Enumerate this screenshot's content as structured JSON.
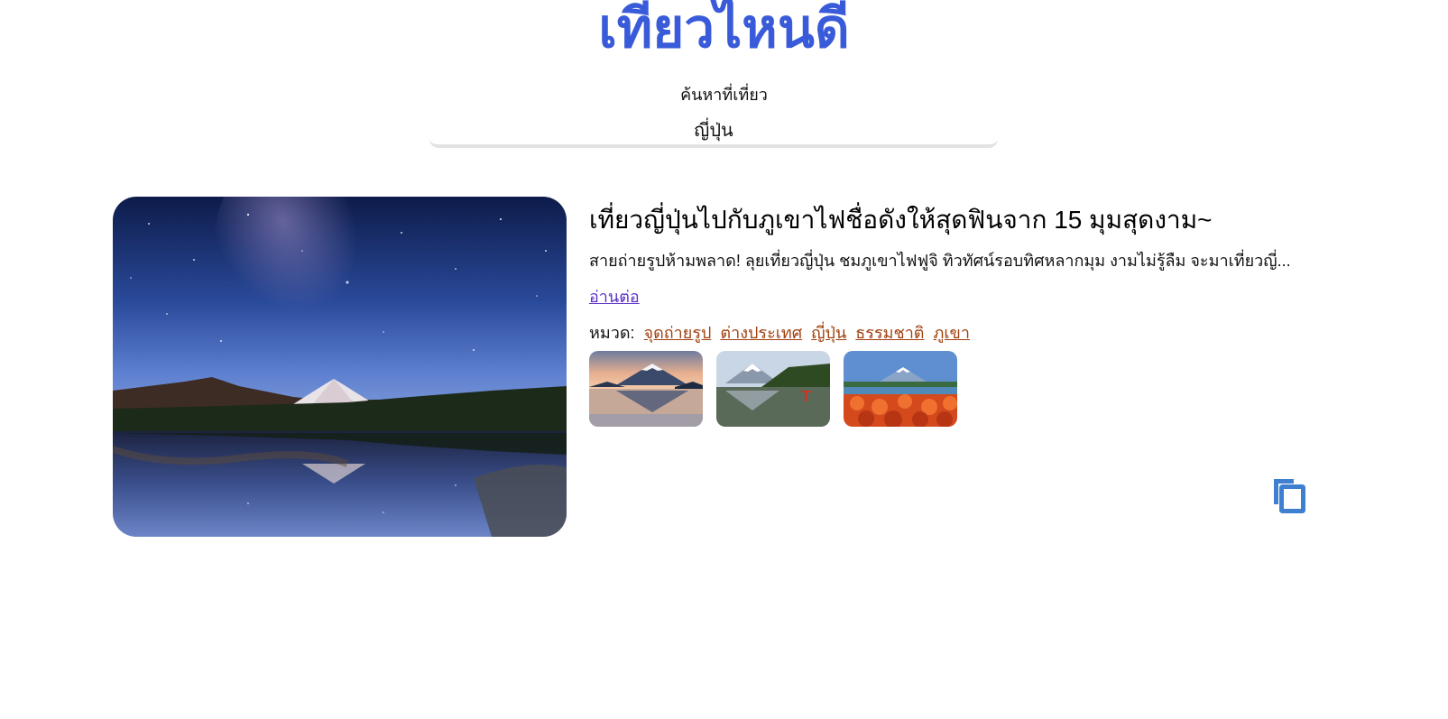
{
  "header": {
    "site_title": "เที่ยวไหนดี",
    "search_label": "ค้นหาที่เที่ยว"
  },
  "search": {
    "value": "ญี่ปุ่น"
  },
  "article": {
    "title": "เที่ยวญี่ปุ่นไปกับภูเขาไฟชื่อดังให้สุดฟินจาก 15 มุมสุดงาม~",
    "excerpt": "สายถ่ายรูปห้ามพลาด! ลุยเที่ยวญี่ปุ่น ชมภูเขาไฟฟูจิ ทิวทัศน์รอบทิศหลากมุม งามไม่รู้ลืม จะมาเที่ยวญี่...",
    "read_more": "อ่านต่อ",
    "category_label": "หมวด:",
    "categories": [
      "จุดถ่ายรูป",
      "ต่างประเทศ",
      "ญี่ปุ่น",
      "ธรรมชาติ",
      "ภูเขา"
    ]
  },
  "icons": {
    "copy": "copy-icon"
  },
  "colors": {
    "title_blue": "#3a5bd9",
    "category_link": "#a0400f",
    "read_more_link": "#5a2fc7",
    "copy_icon": "#3f7fd0"
  }
}
